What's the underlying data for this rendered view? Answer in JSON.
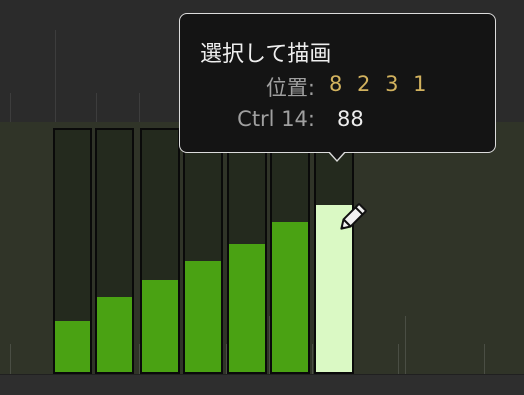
{
  "tooltip": {
    "title": "選択して描画",
    "position_label": "位置:",
    "position_value": "8 2 3 1",
    "controller_label": "Ctrl 14:",
    "controller_value": "88"
  },
  "colors": {
    "value_bar": "#4aa213",
    "selected_bar": "#daf9c4",
    "position_value": "#d2b25e",
    "lane_background": "#303428"
  },
  "tool_icon": "pencil-icon",
  "bars": [
    {
      "level": 0.21,
      "selected": false
    },
    {
      "level": 0.31,
      "selected": false
    },
    {
      "level": 0.38,
      "selected": false
    },
    {
      "level": 0.46,
      "selected": false
    },
    {
      "level": 0.53,
      "selected": false
    },
    {
      "level": 0.62,
      "selected": false
    },
    {
      "level": 0.69,
      "selected": true
    }
  ]
}
